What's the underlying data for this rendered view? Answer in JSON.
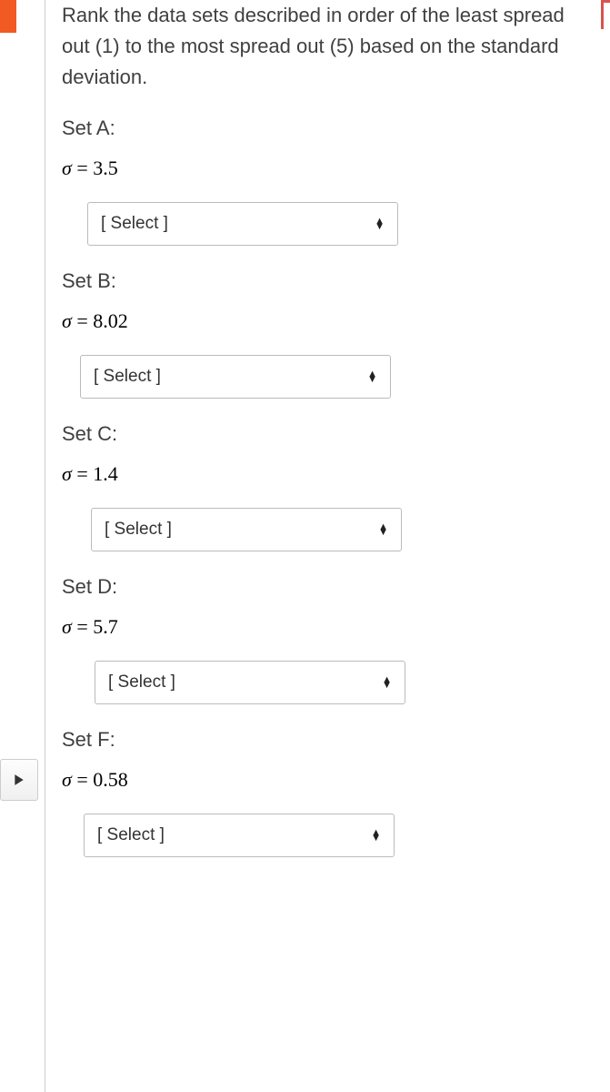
{
  "question": "Rank the data sets described in order of the least spread out (1) to the most spread out (5) based on the standard deviation.",
  "select_placeholder": "[ Select ]",
  "sets": {
    "a": {
      "label": "Set A:",
      "sigma_value": "3.5"
    },
    "b": {
      "label": "Set B:",
      "sigma_value": "8.02"
    },
    "c": {
      "label": "Set C:",
      "sigma_value": "1.4"
    },
    "d": {
      "label": "Set D:",
      "sigma_value": "5.7"
    },
    "f": {
      "label": "Set F:",
      "sigma_value": "0.58"
    }
  }
}
